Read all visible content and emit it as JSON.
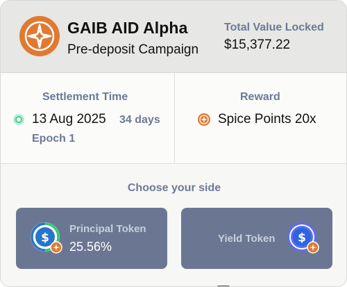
{
  "header": {
    "title": "GAIB AID Alpha",
    "subtitle": "Pre-deposit Campaign",
    "tvl_label": "Total Value Locked",
    "tvl_value": "$15,377.22"
  },
  "settlement": {
    "label": "Settlement Time",
    "date": "13 Aug 2025",
    "days": "34 days",
    "epoch": "Epoch 1",
    "status_color": "#3ecf8e"
  },
  "reward": {
    "label": "Reward",
    "value": "Spice Points 20x",
    "icon": "spice-icon"
  },
  "side": {
    "label": "Choose your side",
    "principal": {
      "label": "Principal Token",
      "value": "25.56%",
      "icon": "usdc-principal-icon"
    },
    "yield": {
      "label": "Yield Token",
      "icon": "usdc-yield-icon"
    }
  },
  "colors": {
    "brand_orange": "#e07a32",
    "accent_slate": "#6b7a95",
    "button_bg": "#6b7792"
  }
}
